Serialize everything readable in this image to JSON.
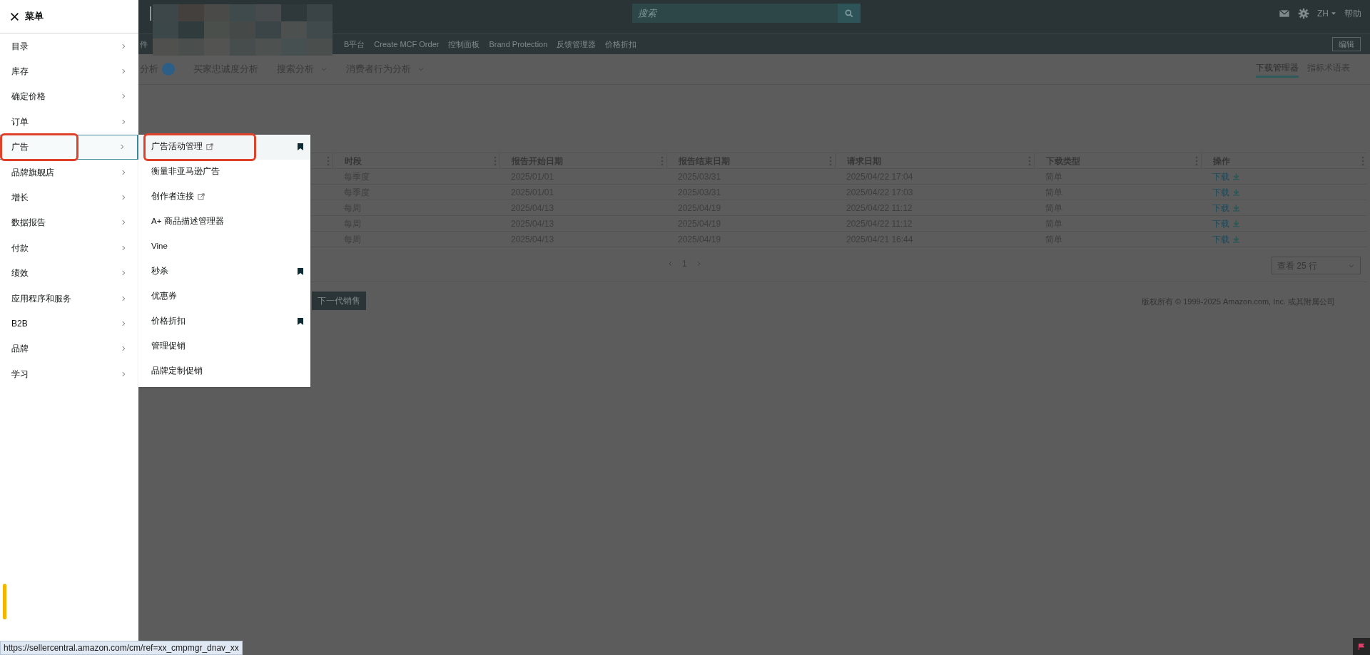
{
  "top_bar": {
    "search": {
      "placeholder": "搜索"
    },
    "language": "ZH",
    "help": "帮助"
  },
  "nav_bar": {
    "items": [
      "件",
      "B平台",
      "Create MCF Order",
      "控制面板",
      "Brand Protection",
      "反馈管理器",
      "价格折扣"
    ],
    "edit_button": "编辑"
  },
  "sub_nav": {
    "items": [
      {
        "label": "分析",
        "kind": "badge"
      },
      {
        "label": "买家忠诚度分析",
        "kind": "plain"
      },
      {
        "label": "搜索分析",
        "kind": "dropdown"
      },
      {
        "label": "消费者行为分析",
        "kind": "dropdown"
      }
    ],
    "links": [
      {
        "label": "下载管理器",
        "selected": true
      },
      {
        "label": "指标术语表",
        "selected": false
      }
    ]
  },
  "table": {
    "columns": [
      "时段",
      "报告开始日期",
      "报告结束日期",
      "请求日期",
      "下载类型",
      "操作"
    ],
    "rows": [
      {
        "period": "每季度",
        "start": "2025/01/01",
        "end": "2025/03/31",
        "requested": "2025/04/22 17:04",
        "type": "简单",
        "action": "下载"
      },
      {
        "period": "每季度",
        "start": "2025/01/01",
        "end": "2025/03/31",
        "requested": "2025/04/22 17:03",
        "type": "简单",
        "action": "下载"
      },
      {
        "period": "每周",
        "start": "2025/04/13",
        "end": "2025/04/19",
        "requested": "2025/04/22 11:12",
        "type": "简单",
        "action": "下载"
      },
      {
        "period": "每周",
        "start": "2025/04/13",
        "end": "2025/04/19",
        "requested": "2025/04/22 11:12",
        "type": "简单",
        "action": "下载"
      },
      {
        "period": "每周",
        "start": "2025/04/13",
        "end": "2025/04/19",
        "requested": "2025/04/21 16:44",
        "type": "简单",
        "action": "下载"
      }
    ]
  },
  "pagination": {
    "page": "1",
    "rows_select": "查看 25 行"
  },
  "footer": {
    "next_gen_button": "下一代销售",
    "copyright": "版权所有 © 1999-2025 Amazon.com, Inc. 或其附属公司"
  },
  "menu": {
    "title": "菜单",
    "items": [
      {
        "label": "目录",
        "selected": false,
        "circled": false
      },
      {
        "label": "库存",
        "selected": false,
        "circled": false
      },
      {
        "label": "确定价格",
        "selected": false,
        "circled": false
      },
      {
        "label": "订单",
        "selected": false,
        "circled": false
      },
      {
        "label": "广告",
        "selected": true,
        "circled": true
      },
      {
        "label": "品牌旗舰店",
        "selected": false,
        "circled": false
      },
      {
        "label": "增长",
        "selected": false,
        "circled": false
      },
      {
        "label": "数据报告",
        "selected": false,
        "circled": false
      },
      {
        "label": "付款",
        "selected": false,
        "circled": false
      },
      {
        "label": "绩效",
        "selected": false,
        "circled": false
      },
      {
        "label": "应用程序和服务",
        "selected": false,
        "circled": false
      },
      {
        "label": "B2B",
        "selected": false,
        "circled": false
      },
      {
        "label": "品牌",
        "selected": false,
        "circled": false
      },
      {
        "label": "学习",
        "selected": false,
        "circled": false
      }
    ],
    "submenu": [
      {
        "label": "广告活动管理",
        "external": true,
        "bookmarked": true,
        "selected": true,
        "circled": true
      },
      {
        "label": "衡量非亚马逊广告",
        "external": false,
        "bookmarked": false,
        "selected": false,
        "circled": false
      },
      {
        "label": "创作者连接",
        "external": true,
        "bookmarked": false,
        "selected": false,
        "circled": false
      },
      {
        "label": "A+ 商品描述管理器",
        "external": false,
        "bookmarked": false,
        "selected": false,
        "circled": false
      },
      {
        "label": "Vine",
        "external": false,
        "bookmarked": false,
        "selected": false,
        "circled": false
      },
      {
        "label": "秒杀",
        "external": false,
        "bookmarked": true,
        "selected": false,
        "circled": false
      },
      {
        "label": "优惠券",
        "external": false,
        "bookmarked": false,
        "selected": false,
        "circled": false
      },
      {
        "label": "价格折扣",
        "external": false,
        "bookmarked": true,
        "selected": false,
        "circled": false
      },
      {
        "label": "管理促销",
        "external": false,
        "bookmarked": false,
        "selected": false,
        "circled": false
      },
      {
        "label": "品牌定制促销",
        "external": false,
        "bookmarked": false,
        "selected": false,
        "circled": false
      }
    ]
  },
  "status_url": "https://sellercentral.amazon.com/cm/ref=xx_cmpmgr_dnav_xx"
}
